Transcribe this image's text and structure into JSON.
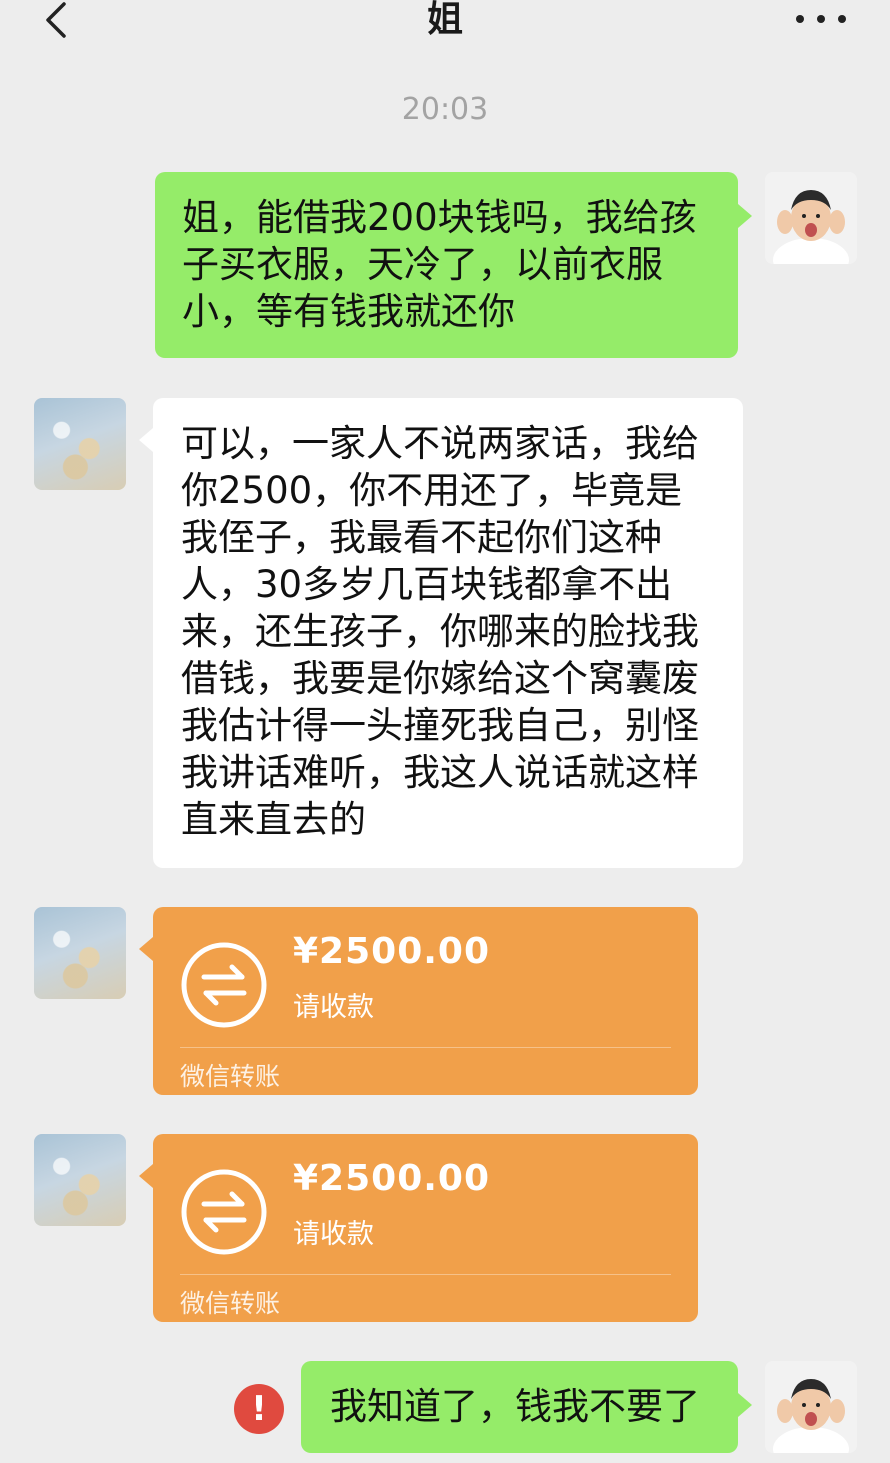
{
  "header": {
    "title": "姐",
    "back_icon": "chevron-left-icon",
    "more_icon": "more-dots-icon"
  },
  "timestamp": "20:03",
  "messages": [
    {
      "sender": "self",
      "type": "text",
      "text": "姐，能借我200块钱吗，我给孩子买衣服，天冷了，以前衣服小，等有钱我就还你"
    },
    {
      "sender": "sister",
      "type": "text",
      "text": "可以，一家人不说两家话，我给你2500，你不用还了，毕竟是我侄子，我最看不起你们这种人，30多岁几百块钱都拿不出来，还生孩子，你哪来的脸找我借钱，我要是你嫁给这个窝囊废我估计得一头撞死我自己，别怪我讲话难听，我这人说话就这样直来直去的"
    },
    {
      "sender": "sister",
      "type": "transfer",
      "amount": "¥2500.00",
      "status": "请收款",
      "label": "微信转账"
    },
    {
      "sender": "sister",
      "type": "transfer",
      "amount": "¥2500.00",
      "status": "请收款",
      "label": "微信转账"
    },
    {
      "sender": "self",
      "type": "text",
      "text": "我知道了，钱我不要了",
      "send_failed": true,
      "error_symbol": "!"
    }
  ],
  "colors": {
    "background": "#ededed",
    "self_bubble": "#95ec69",
    "other_bubble": "#ffffff",
    "transfer_card": "#f1a04a",
    "error_badge": "#e04a3f"
  }
}
